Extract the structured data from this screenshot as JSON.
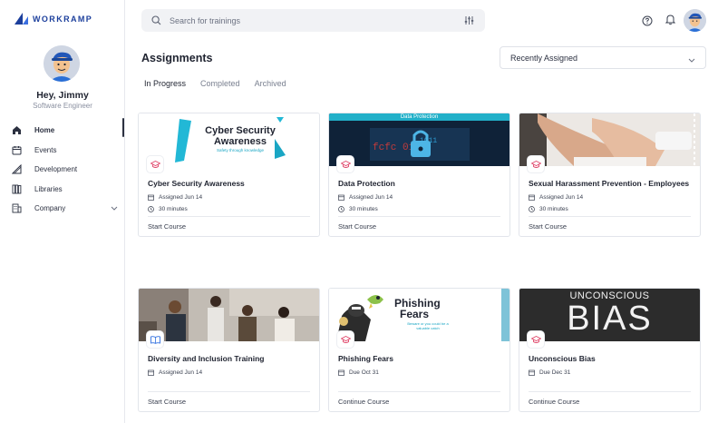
{
  "brand": {
    "name": "WORKRAMP",
    "color": "#1c3f9c"
  },
  "user": {
    "greeting": "Hey, Jimmy",
    "role": "Software Engineer"
  },
  "nav": {
    "items": [
      {
        "label": "Home",
        "icon": "home-icon",
        "active": true
      },
      {
        "label": "Events",
        "icon": "calendar-icon"
      },
      {
        "label": "Development",
        "icon": "development-icon"
      },
      {
        "label": "Libraries",
        "icon": "library-icon"
      },
      {
        "label": "Company",
        "icon": "building-icon"
      }
    ]
  },
  "search": {
    "placeholder": "Search for trainings"
  },
  "page": {
    "title": "Assignments"
  },
  "sort": {
    "selected": "Recently Assigned"
  },
  "tabs": [
    {
      "label": "In Progress",
      "active": true
    },
    {
      "label": "Completed"
    },
    {
      "label": "Archived"
    }
  ],
  "thumbs": {
    "cyber": {
      "line1": "Cyber Security",
      "line2": "Awareness",
      "sub": "Safety through knowledge"
    },
    "data": {
      "banner": "Data Protection"
    },
    "phishing": {
      "line1": "Phishing",
      "line2": "Fears",
      "sub1": "Beware or you could be a",
      "sub2": "valuable catch"
    },
    "bias": {
      "line1": "UNCONSCIOUS",
      "line2": "BIAS"
    }
  },
  "cards": [
    {
      "title": "Cyber Security Awareness",
      "date": "Assigned Jun 14",
      "duration": "30 minutes",
      "action": "Start Course",
      "badge": "graduation-cap-icon"
    },
    {
      "title": "Data Protection",
      "date": "Assigned Jun 14",
      "duration": "30 minutes",
      "action": "Start Course",
      "badge": "graduation-cap-icon"
    },
    {
      "title": "Sexual Harassment Prevention - Employees",
      "date": "Assigned Jun 14",
      "duration": "30 minutes",
      "action": "Start Course",
      "badge": "graduation-cap-icon"
    },
    {
      "title": "Diversity and Inclusion Training",
      "date": "Assigned Jun 14",
      "action": "Start Course",
      "badge": "book-icon"
    },
    {
      "title": "Phishing Fears",
      "date": "Due Oct 31",
      "action": "Continue Course",
      "badge": "graduation-cap-icon"
    },
    {
      "title": "Unconscious Bias",
      "date": "Due Dec 31",
      "action": "Continue Course",
      "badge": "graduation-cap-icon"
    }
  ],
  "colors": {
    "accent": "#e0466a",
    "blue": "#2f6fe0"
  }
}
